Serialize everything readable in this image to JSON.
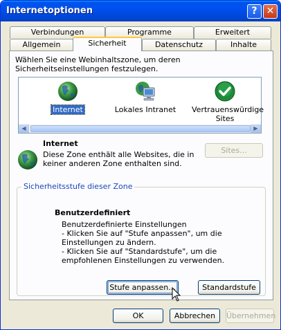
{
  "window": {
    "title": "Internetoptionen",
    "help_label": "?",
    "close_label": "✕"
  },
  "tabs": {
    "row_back": [
      "Verbindungen",
      "Programme",
      "Erweitert"
    ],
    "row_front": [
      "Allgemein",
      "Sicherheit",
      "Datenschutz",
      "Inhalte"
    ],
    "active": "Sicherheit"
  },
  "security": {
    "intro": "Wählen Sie eine Webinhaltszone, um deren Sicherheitseinstellungen festzulegen.",
    "zones": [
      {
        "label": "Internet",
        "icon": "globe-icon",
        "selected": true
      },
      {
        "label": "Lokales Intranet",
        "icon": "intranet-computer-icon",
        "selected": false
      },
      {
        "label": "Vertrauenswürdige Sites",
        "icon": "trusted-check-icon",
        "selected": false
      }
    ],
    "zone_info": {
      "title": "Internet",
      "description": "Diese Zone enthält alle Websites, die in keiner anderen Zone enthalten sind.",
      "sites_button": "Sites..."
    },
    "level_group": {
      "legend": "Sicherheitsstufe dieser Zone",
      "title": "Benutzerdefiniert",
      "lines": [
        "Benutzerdefinierte Einstellungen",
        "- Klicken Sie auf \"Stufe anpassen\", um die Einstellungen zu ändern.",
        "- Klicken Sie auf \"Standardstufe\", um die empfohlenen Einstellungen zu verwenden."
      ],
      "custom_button": "Stufe anpassen...",
      "default_button": "Standardstufe"
    }
  },
  "footer": {
    "ok": "OK",
    "cancel": "Abbrechen",
    "apply": "Übernehmen"
  },
  "colors": {
    "titlebar": "#0053ee",
    "dialog_bg": "#ece9d8",
    "selection": "#316ac5"
  }
}
